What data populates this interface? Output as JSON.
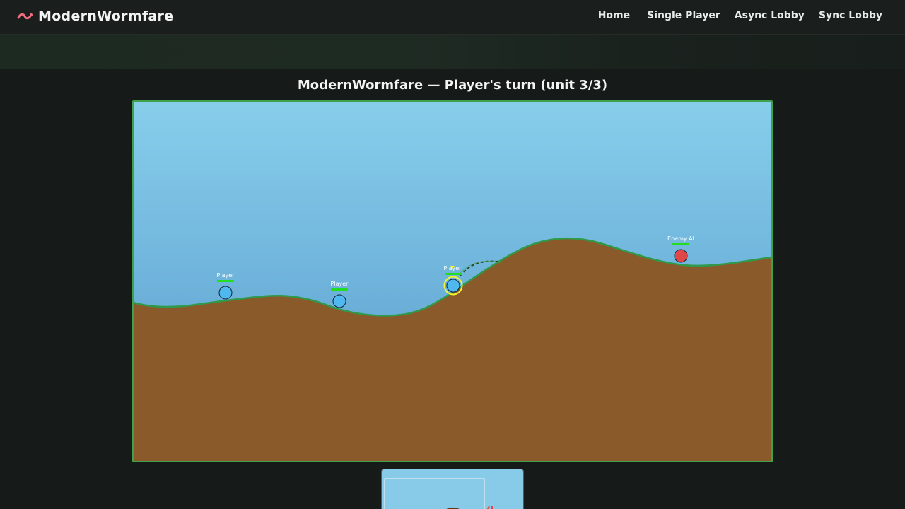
{
  "nav": {
    "brand": "ModernWormfare",
    "links": [
      {
        "label": "Home"
      },
      {
        "label": "Single Player"
      },
      {
        "label": "Async Lobby"
      },
      {
        "label": "Sync Lobby"
      }
    ]
  },
  "game": {
    "title": "ModernWormfare — Player's turn (unit 3/3)",
    "units": [
      {
        "label": "Player",
        "team": "player",
        "active": false
      },
      {
        "label": "Player",
        "team": "player",
        "active": false
      },
      {
        "label": "Player",
        "team": "player",
        "active": true
      },
      {
        "label": "Enemy AI",
        "team": "enemy",
        "active": false
      }
    ]
  },
  "colors": {
    "sky_top": "#87ceeb",
    "sky_bottom": "#6aaed8",
    "ground": "#8b5a2b",
    "grass": "#2e9a4a",
    "player": "#4fb8ee",
    "enemy": "#e04848",
    "health": "#22dd22",
    "active_ring": "#f5f532",
    "border": "#3fa24a",
    "brand_icon": "#f06e82"
  }
}
